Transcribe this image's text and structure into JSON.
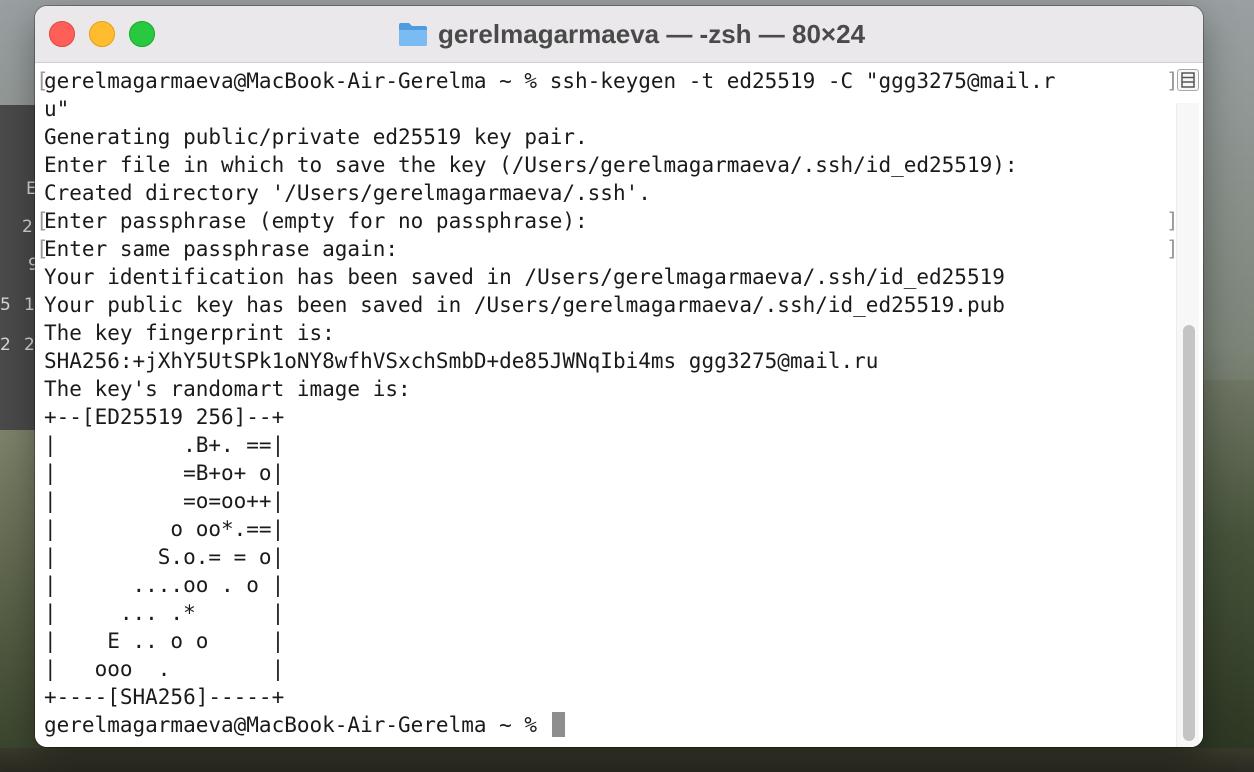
{
  "window": {
    "title": "gerelmagarmaeva — -zsh — 80×24",
    "controls": {
      "close": "close-button",
      "minimize": "minimize-button",
      "zoom": "zoom-button"
    },
    "title_icon": "folder-icon"
  },
  "background": {
    "side_text": [
      "E",
      "2",
      "9",
      "5",
      "1",
      "2",
      "2"
    ]
  },
  "terminal": {
    "lines": [
      "gerelmagarmaeva@MacBook-Air-Gerelma ~ % ssh-keygen -t ed25519 -C \"ggg3275@mail.r",
      "u\"",
      "Generating public/private ed25519 key pair.",
      "Enter file in which to save the key (/Users/gerelmagarmaeva/.ssh/id_ed25519):",
      "Created directory '/Users/gerelmagarmaeva/.ssh'.",
      "Enter passphrase (empty for no passphrase):",
      "Enter same passphrase again:",
      "Your identification has been saved in /Users/gerelmagarmaeva/.ssh/id_ed25519",
      "Your public key has been saved in /Users/gerelmagarmaeva/.ssh/id_ed25519.pub",
      "The key fingerprint is:",
      "SHA256:+jXhY5UtSPk1oNY8wfhVSxchSmbD+de85JWNqIbi4ms ggg3275@mail.ru",
      "The key's randomart image is:",
      "+--[ED25519 256]--+",
      "|          .B+. ==|",
      "|          =B+o+ o|",
      "|          =o=oo++|",
      "|         o oo*.==|",
      "|        S.o.= = o|",
      "|      ....oo . o |",
      "|     ... .*      |",
      "|    E .. o o     |",
      "|   ooo  .        |",
      "+----[SHA256]-----+",
      "gerelmagarmaeva@MacBook-Air-Gerelma ~ % "
    ],
    "bracket_left_char": "[",
    "bracket_right_char": "]",
    "marked_left_lines": [
      0,
      5,
      6
    ],
    "marked_right_lines": [
      0,
      5,
      6
    ]
  },
  "scrollbar": {
    "button_icon": "list-icon"
  },
  "colors": {
    "close": "#ff5f57",
    "minimize": "#febc2e",
    "zoom": "#28c840",
    "folder": "#5aa6e8"
  }
}
